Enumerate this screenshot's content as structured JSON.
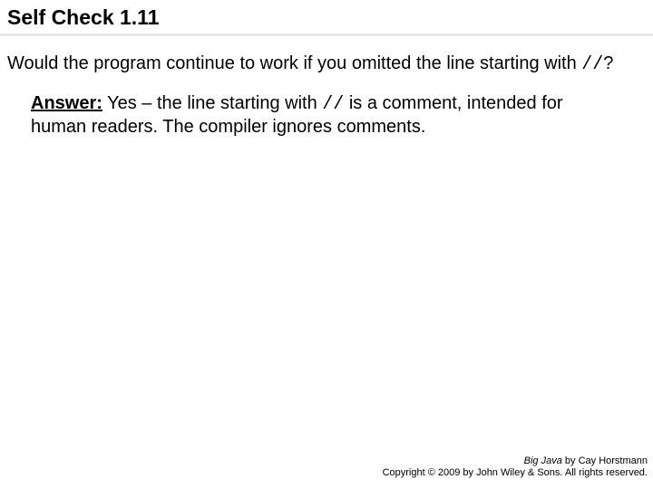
{
  "title": "Self Check 1.11",
  "question": {
    "part1": "Would the program continue to work if you omitted the line starting with ",
    "code": "//",
    "part2": "?"
  },
  "answer": {
    "label": "Answer:",
    "part1": " Yes – the line starting with ",
    "code": "//",
    "part2": " is a comment, intended for human readers. The compiler ignores comments."
  },
  "footer": {
    "book": "Big Java",
    "byline": " by Cay Horstmann",
    "copyright": "Copyright © 2009 by John Wiley & Sons. All rights reserved."
  }
}
